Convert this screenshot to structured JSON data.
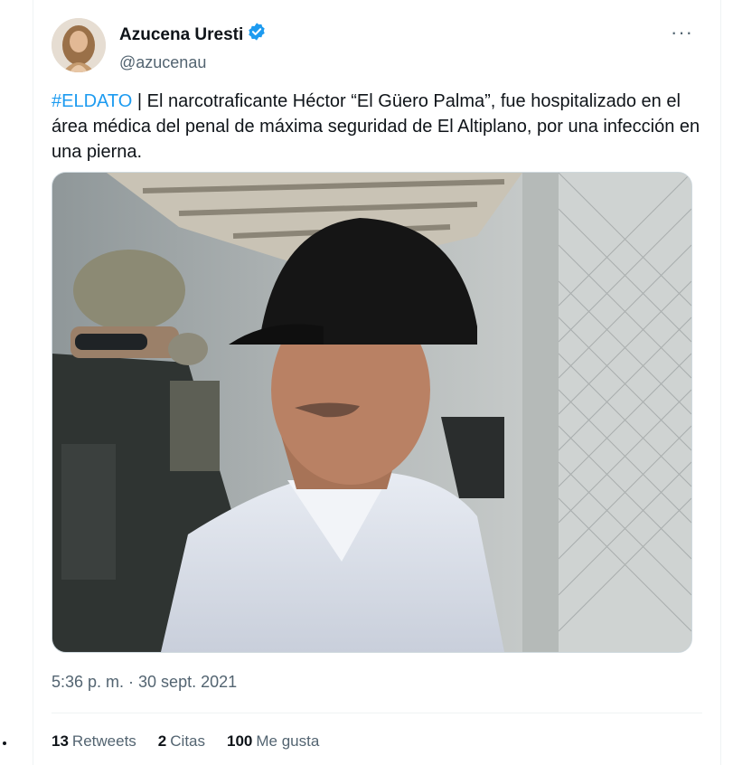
{
  "author": {
    "name": "Azucena Uresti",
    "handle": "@azucenau",
    "verified": true,
    "verified_color": "#1d9bf0"
  },
  "more_menu": {
    "label": "···"
  },
  "tweet": {
    "hashtag": "#ELDATO",
    "separator": " | ",
    "text": "El narcotraficante Héctor “El Güero Palma”, fue hospitalizado en el área médica del penal de máxima seguridad de El Altiplano, por una infección en una pierna."
  },
  "timestamp": "5:36 p. m. · 30 sept. 2021",
  "stats": {
    "retweets": {
      "count": "13",
      "label": "Retweets"
    },
    "quotes": {
      "count": "2",
      "label": "Citas"
    },
    "likes": {
      "count": "100",
      "label": "Me gusta"
    }
  },
  "colors": {
    "accent": "#1d9bf0",
    "secondary_text": "#536471",
    "primary_text": "#0f1419"
  }
}
